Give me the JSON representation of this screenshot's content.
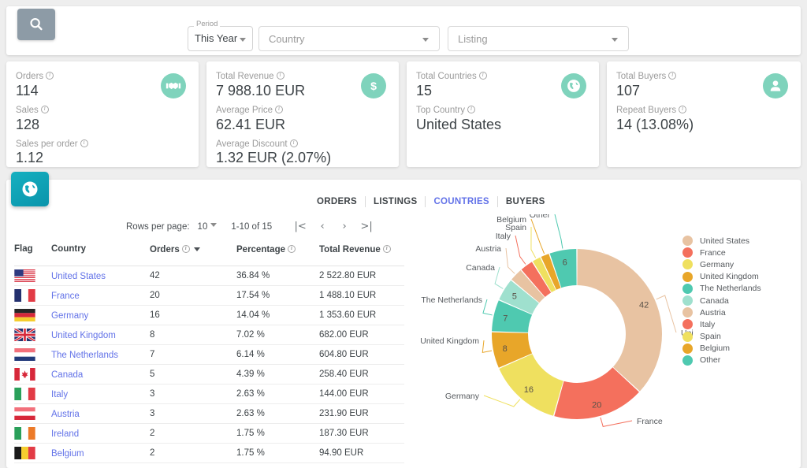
{
  "search": {
    "icon": "search-icon"
  },
  "filters": {
    "period": {
      "legend": "Period",
      "value": "This Year"
    },
    "country": {
      "placeholder": "Country"
    },
    "listing": {
      "placeholder": "Listing"
    }
  },
  "cards": [
    {
      "icon": "handshake-icon",
      "rows": [
        {
          "label": "Orders",
          "value": "114"
        },
        {
          "label": "Sales",
          "value": "128"
        },
        {
          "label": "Sales per order",
          "value": "1.12"
        }
      ]
    },
    {
      "icon": "dollar-icon",
      "rows": [
        {
          "label": "Total Revenue",
          "value": "7 988.10 EUR"
        },
        {
          "label": "Average Price",
          "value": "62.41 EUR"
        },
        {
          "label": "Average Discount",
          "value": "1.32 EUR (2.07%)"
        }
      ]
    },
    {
      "icon": "globe-icon",
      "rows": [
        {
          "label": "Total Countries",
          "value": "15"
        },
        {
          "label": "Top Country",
          "value": "United States"
        }
      ]
    },
    {
      "icon": "person-icon",
      "rows": [
        {
          "label": "Total Buyers",
          "value": "107"
        },
        {
          "label": "Repeat Buyers",
          "value": "14 (13.08%)"
        }
      ]
    }
  ],
  "panel": {
    "icon": "globe-icon",
    "tabs": [
      {
        "label": "ORDERS",
        "active": false
      },
      {
        "label": "LISTINGS",
        "active": false
      },
      {
        "label": "COUNTRIES",
        "active": true
      },
      {
        "label": "BUYERS",
        "active": false
      }
    ],
    "paginator": {
      "rows_per_page_label": "Rows per page:",
      "rows_per_page_value": "10",
      "range": "1-10 of 15",
      "first_icon": "|<",
      "prev_icon": "‹",
      "next_icon": "›",
      "last_icon": ">|"
    },
    "table": {
      "columns": [
        "Flag",
        "Country",
        "Orders",
        "Percentage",
        "Total Revenue"
      ],
      "sorted_column": "Orders",
      "rows": [
        {
          "flag": "us",
          "country": "United States",
          "orders": "42",
          "percentage": "36.84 %",
          "revenue": "2 522.80 EUR"
        },
        {
          "flag": "fr",
          "country": "France",
          "orders": "20",
          "percentage": "17.54 %",
          "revenue": "1 488.10 EUR"
        },
        {
          "flag": "de",
          "country": "Germany",
          "orders": "16",
          "percentage": "14.04 %",
          "revenue": "1 353.60 EUR"
        },
        {
          "flag": "gb",
          "country": "United Kingdom",
          "orders": "8",
          "percentage": "7.02 %",
          "revenue": "682.00 EUR"
        },
        {
          "flag": "nl",
          "country": "The Netherlands",
          "orders": "7",
          "percentage": "6.14 %",
          "revenue": "604.80 EUR"
        },
        {
          "flag": "ca",
          "country": "Canada",
          "orders": "5",
          "percentage": "4.39 %",
          "revenue": "258.40 EUR"
        },
        {
          "flag": "it",
          "country": "Italy",
          "orders": "3",
          "percentage": "2.63 %",
          "revenue": "144.00 EUR"
        },
        {
          "flag": "at",
          "country": "Austria",
          "orders": "3",
          "percentage": "2.63 %",
          "revenue": "231.90 EUR"
        },
        {
          "flag": "ie",
          "country": "Ireland",
          "orders": "2",
          "percentage": "1.75 %",
          "revenue": "187.30 EUR"
        },
        {
          "flag": "be",
          "country": "Belgium",
          "orders": "2",
          "percentage": "1.75 %",
          "revenue": "94.90 EUR"
        }
      ]
    }
  },
  "chart_data": {
    "type": "pie",
    "variant": "donut",
    "title": "",
    "categories": [
      "United States",
      "France",
      "Germany",
      "United Kingdom",
      "The Netherlands",
      "Canada",
      "Austria",
      "Italy",
      "Spain",
      "Belgium",
      "Other"
    ],
    "values": [
      42,
      20,
      16,
      8,
      7,
      5,
      3,
      3,
      2,
      2,
      6
    ],
    "visible_slice_labels": [
      "42",
      "20",
      "16",
      "8",
      "7",
      "5",
      "6"
    ],
    "colors": [
      "#e8c3a2",
      "#f4705d",
      "#efe05f",
      "#e8a629",
      "#4fc9b0",
      "#9fe0ce",
      "#e8c3a2",
      "#f4705d",
      "#efe05f",
      "#e8a629",
      "#4fc9b0"
    ],
    "legend_position": "right",
    "legend": [
      "United States",
      "France",
      "Germany",
      "United Kingdom",
      "The Netherlands",
      "Canada",
      "Austria",
      "Italy",
      "Spain",
      "Belgium",
      "Other"
    ]
  }
}
